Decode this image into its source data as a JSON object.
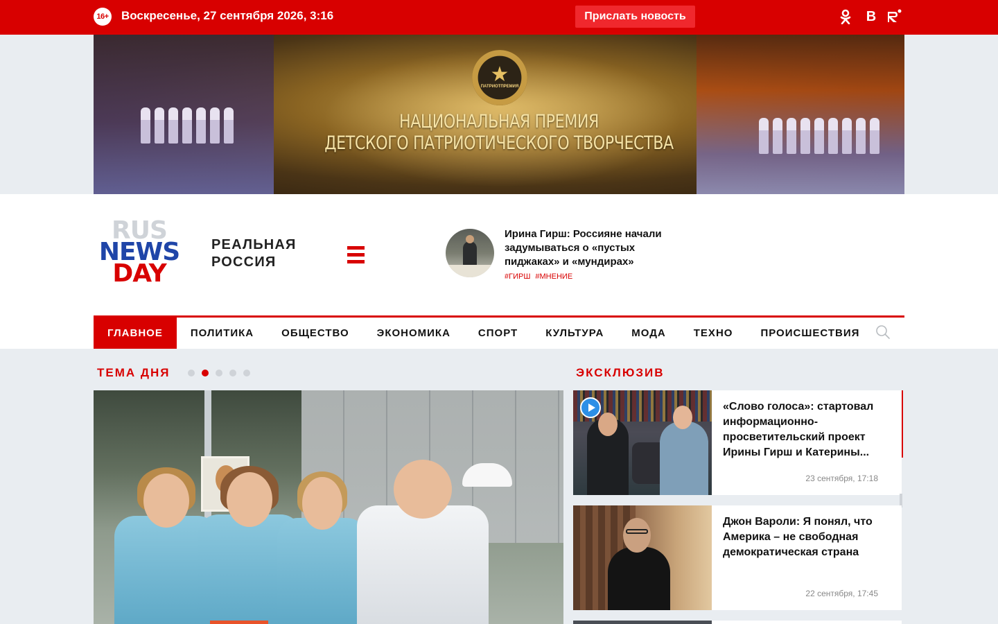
{
  "topbar": {
    "age_rating": "16+",
    "datetime": "Воскресенье, 27 сентября 2026, 3:16",
    "send_news_label": "Прислать новость",
    "social": {
      "ok": "ok-icon",
      "vk": "В",
      "rutube": "R"
    }
  },
  "banner": {
    "medal_text": "ПАТРИОТПРЕМИЯ",
    "title_line1": "НАЦИОНАЛЬНАЯ ПРЕМИЯ",
    "title_line2": "ДЕТСКОГО ПАТРИОТИЧЕСКОГО ТВОРЧЕСТВА"
  },
  "header": {
    "logo": {
      "line1": "RUS",
      "line2": "NEWS",
      "line3": "DAY"
    },
    "tagline": "РЕАЛЬНАЯ РОССИЯ",
    "feature": {
      "title": "Ирина Гирш: Россияне начали задумываться о «пустых пиджаках» и «мундирах»",
      "tags": [
        "#ГИРШ",
        "#МНЕНИЕ"
      ]
    }
  },
  "nav": {
    "items": [
      {
        "label": "ГЛАВНОЕ",
        "active": true
      },
      {
        "label": "ПОЛИТИКА"
      },
      {
        "label": "ОБЩЕСТВО"
      },
      {
        "label": "ЭКОНОМИКА"
      },
      {
        "label": "СПОРТ"
      },
      {
        "label": "КУЛЬТУРА"
      },
      {
        "label": "МОДА"
      },
      {
        "label": "ТЕХНО"
      },
      {
        "label": "ПРОИСШЕСТВИЯ"
      }
    ],
    "search_icon": "search-icon"
  },
  "main": {
    "topic_heading": "ТЕМА ДНЯ",
    "slider": {
      "count": 5,
      "active_index": 1
    },
    "exclusive_heading": "ЭКСКЛЮЗИВ",
    "exclusive": [
      {
        "title": "«Слово голоса»: стартовал информационно-просветительский проект Ирины Гирш и Катерины...",
        "time": "23 сентября, 17:18",
        "has_video": true
      },
      {
        "title": "Джон Вароли: Я понял, что Америка – не свободная демократическая страна",
        "time": "22 сентября, 17:45",
        "has_video": false
      }
    ]
  },
  "colors": {
    "brand_red": "#d80000",
    "logo_blue": "#1f45a8",
    "logo_grey": "#cfd3d8",
    "page_bg": "#e9edf1",
    "play_blue": "#2d8fe6"
  }
}
